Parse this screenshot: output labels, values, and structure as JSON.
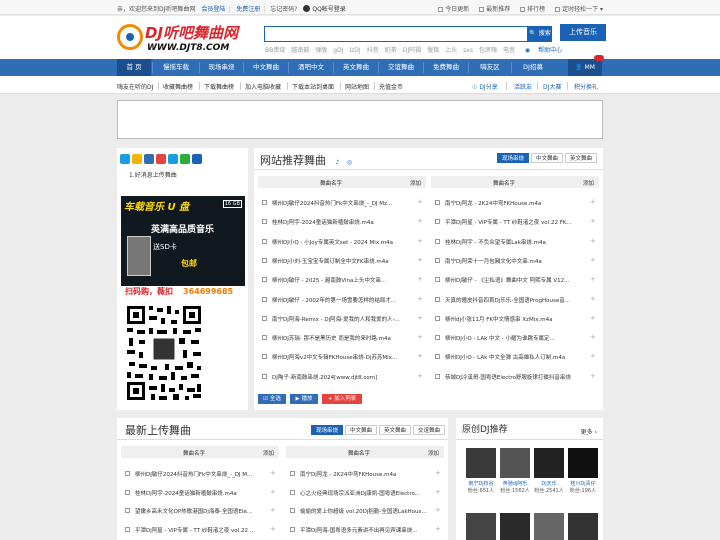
{
  "topbar": {
    "welcome": "亲，欢迎您来到DJ听吧舞曲网",
    "login": "会员登陆",
    "register": "免费注册",
    "forgot": "忘记密码?",
    "qq_login": "QQ帐号登录",
    "right_items": [
      "今日更新",
      "最新推荐",
      "排行榜",
      "定时轻松一下"
    ]
  },
  "header": {
    "logo_title": "DJ听吧舞曲网",
    "logo_url": "WWW.DJT8.COM",
    "search_button": "搜索",
    "hot_words": [
      "BB串烧",
      "越南鼓",
      "弹版",
      "gDJ",
      "lzDJ",
      "抖音",
      "奶茶",
      "DJ阿福",
      "慢摇",
      "上头",
      "sxs",
      "包房嗨",
      "电音"
    ],
    "help": "帮助中心",
    "upload_button": "上传音乐"
  },
  "nav": {
    "items": [
      "首 页",
      "慢摇车载",
      "现场串烧",
      "中文舞曲",
      "酒吧中文",
      "英文舞曲",
      "交谊舞曲",
      "免费舞曲",
      "嗨友区",
      "DJ招募"
    ],
    "user": "MM"
  },
  "subnav": {
    "left": [
      "嗨友在听的DJ",
      "收藏舞曲榜",
      "下载舞曲榜",
      "加入电脑收藏",
      "下载本站到桌面",
      "网站地图",
      "充值金币"
    ],
    "right": [
      "DJ分享",
      "活跃友",
      "DJ大赛",
      "积分换礼"
    ]
  },
  "leftcol": {
    "new_msg": "1.好消息上传舞曲",
    "usb_title": "车载音乐 U 盘",
    "usb_sub": "英满高品质音乐",
    "usb_line3": "送SD卡",
    "usb_line4": "包邮",
    "usb_gb": "16 GB",
    "scan_text": "扫码购，薇扣",
    "scan_number": "364699685"
  },
  "recommend": {
    "title": "网站推荐舞曲",
    "tabs": [
      "现场串烧",
      "中文舞曲",
      "英文舞曲"
    ],
    "col_name": "舞曲名字",
    "col_add": "添加",
    "left_rows": [
      "柳州DJ敏仔2024抖音热门Fk中文串烧_-_DJ Mz...",
      "桂林Dj阿宇-2024童话猫新嗑鼓串烧.m4a",
      "柳州DJ小Q - 小Joy专属英文set - 2024 Mix.m4a",
      "柳州DJ小刘-玉宝宝专属订制全中文FK串烧.m4a",
      "柳州DJ敏仔 - 2025 - 越南鼓Vina上头中文串...",
      "柳州DJ敏仔 - 2002年的第一场雪要怎样的结局才...",
      "南宁Dj阿海-Remix - Dj阿海-爱我的人和我爱的人-...",
      "柳州DJ苏瑞- 那不是黑历史 而是我的来时路.m4a",
      "柳州DJ阿海v2中文专辑FKHouse串烧-Dj苏苏Mix...",
      "DJ陶子-新南鼓串烧.2024[www.djt8.com]"
    ],
    "right_rows": [
      "南宁Dj阿龙 - 2K24中弯FKHouse.m4a",
      "平潭Dj阿星 - VIP专属 - TT 纱鞋渚之夜 vol.22 FK...",
      "桂林Dj阿宇 - 不负众望专属Lak串烧.m4a",
      "南宁Dj阿荣十一月包厢文化中文串.m4a",
      "柳州DJ敏仔 - 《尘私语》舞曲中文 阿熙专属 V12...",
      "天真的瞳皮抖音四首Dj乐乐-全国语ProgHouse音...",
      "柳州dj小张11月 FK中文情感串 XzMix.m4a",
      "柳州DJ小O - LAk 中文 - 小耀为谁跳专属定...",
      "柳州DJ小O - LAk 中文全弹 古高雄私人订制.m4a",
      "恭城DJ冷溪哥-国粤语Electro舒服旋律打碟抖音串烧"
    ],
    "btn_all": "全选",
    "btn_play": "播放",
    "btn_add": "加入列表"
  },
  "newest": {
    "title": "最新上传舞曲",
    "tabs": [
      "现场串烧",
      "中文舞曲",
      "英文舞曲",
      "交谊舞曲"
    ],
    "col_name": "舞曲名字",
    "col_add": "添加",
    "left_rows": [
      "柳州DJ敏仔2024抖音热门Fk中文串烧_-_DJ M...",
      "桂林Dj阿宇-2024童话猫新嗑鼓串烧.m4a",
      "望嫩乡高禾文化OP热歌港国Dj海泰-全国语Ele...",
      "平潭Dj阿星 - VIP专属 - TT 纱鞋渚之夜 vol.22 ..."
    ],
    "right_rows": [
      "南宁Dj阿龙 - 2K24中弯FKHouse.m4a",
      "心之火经典现场宗派亚洲Dj康凯-国粤语Electro...",
      "偷偷的爱上你超级 vol.20Dj稻勤-全国语LakHous...",
      "平潭Dj阿海-国粤语多元素讲不出再见宾课串烧..."
    ]
  },
  "original": {
    "title": "原创DJ推荐",
    "more": "更多",
    "djs": [
      {
        "name": "南宁Dj权谷",
        "score": "粉丝:651人"
      },
      {
        "name": "奔驰dj阿乐",
        "score": "粉丝:1562人"
      },
      {
        "name": "Dj天乐",
        "score": "粉丝:2541人"
      },
      {
        "name": "桂川Dj青仔",
        "score": "粉丝:196人"
      }
    ]
  },
  "colors": {
    "primary": "#2f6eb7",
    "accent": "#d8262c",
    "orange": "#f28b00"
  }
}
